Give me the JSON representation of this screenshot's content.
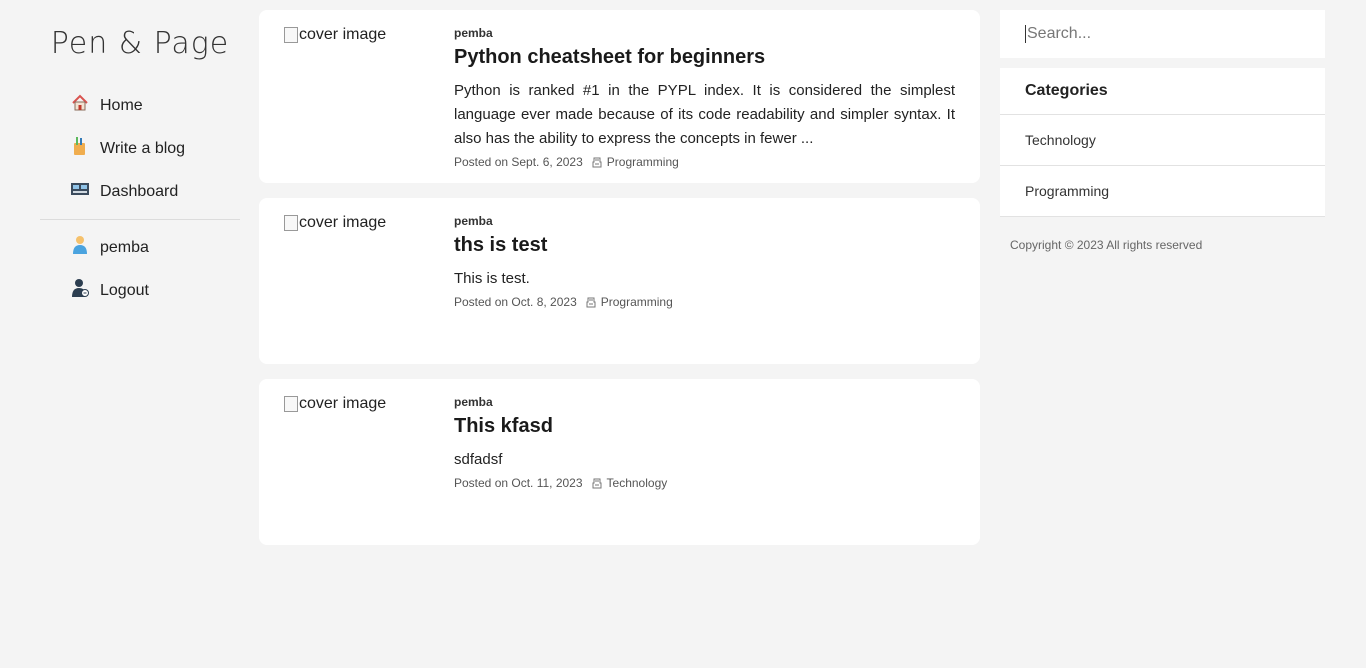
{
  "logo": "Pen & Page",
  "nav": [
    {
      "label": "Home",
      "icon": "home-icon"
    },
    {
      "label": "Write a blog",
      "icon": "write-icon"
    },
    {
      "label": "Dashboard",
      "icon": "dashboard-icon"
    }
  ],
  "user_nav": [
    {
      "label": "pemba",
      "icon": "user-icon"
    },
    {
      "label": "Logout",
      "icon": "logout-icon"
    }
  ],
  "posts": [
    {
      "cover_alt": "cover image",
      "author": "pemba",
      "title": "Python cheatsheet for beginners",
      "excerpt": "Python is ranked #1 in the PYPL index. It is considered the simplest language ever made because of its code readability and simpler syntax. It also has the ability to express the concepts in fewer ...",
      "posted": "Posted on Sept. 6, 2023",
      "category": "Programming"
    },
    {
      "cover_alt": "cover image",
      "author": "pemba",
      "title": "ths is test",
      "excerpt": "This is test.",
      "posted": "Posted on Oct. 8, 2023",
      "category": "Programming"
    },
    {
      "cover_alt": "cover image",
      "author": "pemba",
      "title": "This kfasd",
      "excerpt": "sdfadsf",
      "posted": "Posted on Oct. 11, 2023",
      "category": "Technology"
    }
  ],
  "search": {
    "placeholder": "Search..."
  },
  "categories": {
    "heading": "Categories",
    "items": [
      "Technology",
      "Programming"
    ]
  },
  "copyright": "Copyright © 2023 All rights reserved"
}
